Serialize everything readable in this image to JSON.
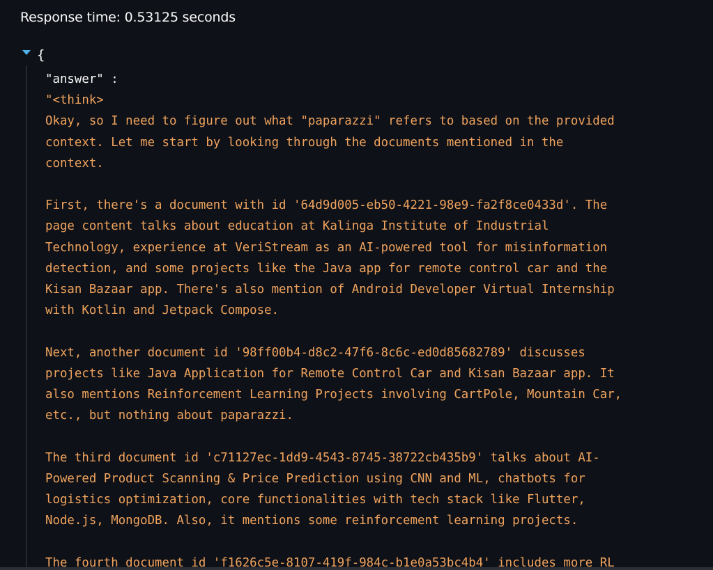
{
  "header": {
    "response_time": "Response time: 0.53125 seconds"
  },
  "json_viewer": {
    "open_brace": "{",
    "key": "\"answer\"",
    "colon": " :",
    "answer_value": "\"<think>\nOkay, so I need to figure out what \"paparazzi\" refers to based on the provided\ncontext. Let me start by looking through the documents mentioned in the\ncontext.\n\nFirst, there's a document with id '64d9d005-eb50-4221-98e9-fa2f8ce0433d'. The\npage content talks about education at Kalinga Institute of Industrial\nTechnology, experience at VeriStream as an AI-powered tool for misinformation\ndetection, and some projects like the Java app for remote control car and the\nKisan Bazaar app. There's also mention of Android Developer Virtual Internship\nwith Kotlin and Jetpack Compose.\n\nNext, another document id '98ff00b4-d8c2-47f6-8c6c-ed0d85682789' discusses\nprojects like Java Application for Remote Control Car and Kisan Bazaar app. It\nalso mentions Reinforcement Learning Projects involving CartPole, Mountain Car,\netc., but nothing about paparazzi.\n\nThe third document id 'c71127ec-1dd9-4543-8745-38722cb435b9' talks about AI-\nPowered Product Scanning & Price Prediction using CNN and ML, chatbots for\nlogistics optimization, core functionalities with tech stack like Flutter,\nNode.js, MongoDB. Also, it mentions some reinforcement learning projects.\n\nThe fourth document id 'f1626c5e-8107-419f-984c-b1e0a53bc4b4' includes more RL"
  },
  "colors": {
    "background": "#0e1117",
    "text": "#fafafa",
    "string_value": "#f0a35e",
    "toggle_arrow": "#4fb3e8",
    "guide_line": "#3b3f48"
  },
  "icons": {
    "toggle": "caret-down-icon"
  }
}
